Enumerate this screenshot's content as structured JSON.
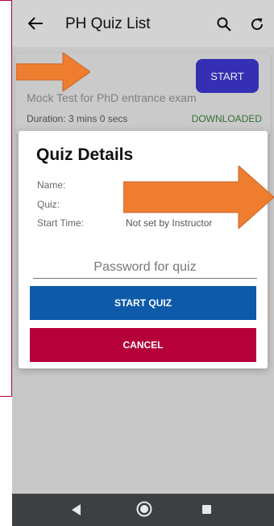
{
  "appbar": {
    "title": "PH Quiz List",
    "back_icon": "arrow-left-icon",
    "search_icon": "search-icon",
    "refresh_icon": "refresh-icon"
  },
  "card": {
    "start_label": "START",
    "title": "Mock Test for PhD entrance exam",
    "duration": "Duration: 3 mins 0 secs",
    "status": "DOWNLOADED"
  },
  "dialog": {
    "title": "Quiz Details",
    "name_label": "Name:",
    "quiz_label": "Quiz:",
    "start_time_label": "Start Time:",
    "start_time_value": "Not set by Instructor",
    "password_placeholder": "Password for quiz",
    "start_button": "START QUIZ",
    "cancel_button": "CANCEL"
  },
  "navbar": {
    "back_icon": "nav-back-icon",
    "home_icon": "nav-home-icon",
    "recent_icon": "nav-recent-icon"
  },
  "colors": {
    "start_button": "#3a34c4",
    "start_quiz_button": "#0d5aa8",
    "cancel_button": "#b5003a",
    "downloaded": "#3a7a3a",
    "annotation_arrow": "#ee7d30"
  }
}
